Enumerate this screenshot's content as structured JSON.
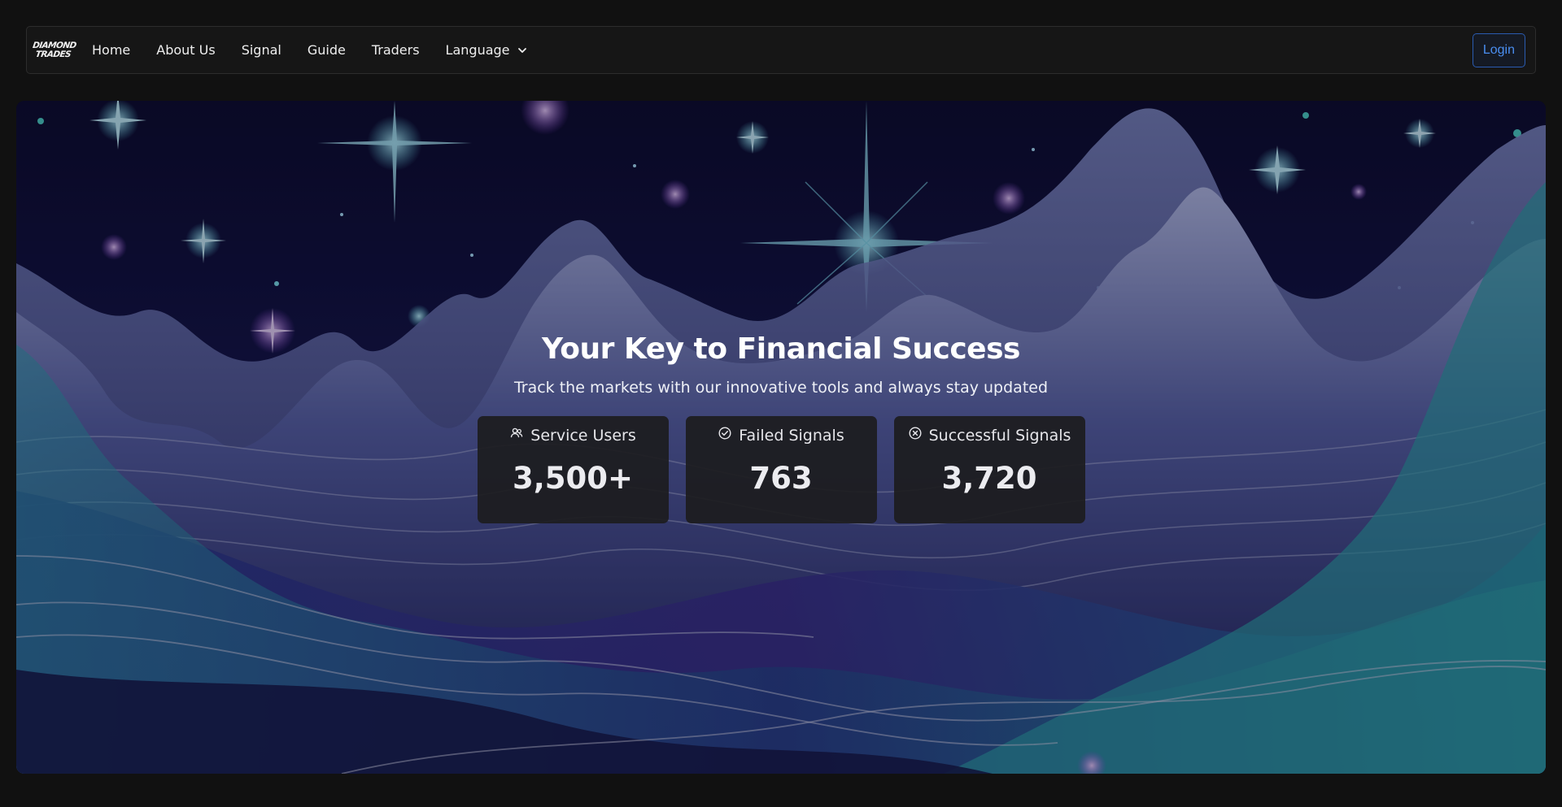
{
  "brand": {
    "logo_line1": "DIAMOND",
    "logo_line2": "TRADES"
  },
  "nav": {
    "items": [
      {
        "label": "Home"
      },
      {
        "label": "About Us"
      },
      {
        "label": "Signal"
      },
      {
        "label": "Guide"
      },
      {
        "label": "Traders"
      },
      {
        "label": "Language",
        "icon": "chevron-down-icon"
      }
    ],
    "login_label": "Login"
  },
  "hero": {
    "title": "Your Key to Financial Success",
    "subtitle": "Track the markets with our innovative tools and always stay updated",
    "stats": [
      {
        "label": "Service Users",
        "value": "3,500+",
        "icon": "users-icon"
      },
      {
        "label": "Failed Signals",
        "value": "763",
        "icon": "check-circle-icon"
      },
      {
        "label": "Successful Signals",
        "value": "3,720",
        "icon": "x-circle-icon"
      }
    ]
  },
  "colors": {
    "page_bg": "#111111",
    "nav_bg": "#161616",
    "accent": "#4a8ef0",
    "teal": "#2fb0b0",
    "purple": "#8a4de0"
  }
}
